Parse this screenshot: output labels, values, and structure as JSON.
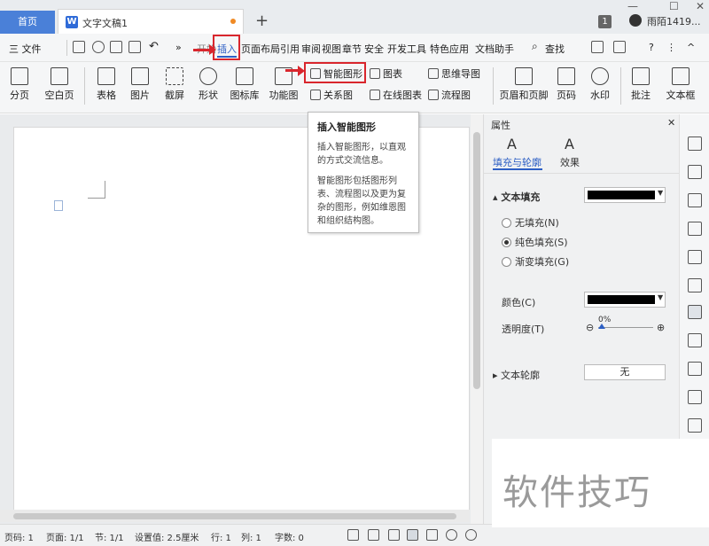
{
  "titlebar": {
    "home_tab": "首页",
    "doc_tab": "文字文稿1",
    "badge": "1",
    "user": "雨陌1419..."
  },
  "menubar": {
    "file": "三 文件",
    "tabs": [
      "开始",
      "插入",
      "页面布局",
      "引用",
      "审阅",
      "视图",
      "章节",
      "安全",
      "开发工具",
      "特色应用",
      "文档助手"
    ],
    "search": "查找"
  },
  "ribbon": {
    "big_buttons": [
      {
        "label": "分页",
        "icon": "page-break-icon"
      },
      {
        "label": "空白页",
        "icon": "blank-page-icon"
      },
      {
        "label": "表格",
        "icon": "table-icon"
      },
      {
        "label": "图片",
        "icon": "picture-icon"
      },
      {
        "label": "截屏",
        "icon": "screenshot-icon"
      },
      {
        "label": "形状",
        "icon": "shape-icon"
      },
      {
        "label": "图标库",
        "icon": "icon-library-icon"
      },
      {
        "label": "功能图",
        "icon": "function-chart-icon"
      },
      {
        "label": "页眉和页脚",
        "icon": "header-footer-icon"
      },
      {
        "label": "页码",
        "icon": "page-number-icon"
      },
      {
        "label": "水印",
        "icon": "watermark-icon"
      },
      {
        "label": "批注",
        "icon": "comment-icon"
      },
      {
        "label": "文本框",
        "icon": "textbox-icon"
      }
    ],
    "smart_art": "智能图形",
    "chart": "图表",
    "mindmap": "思维导图",
    "relation": "关系图",
    "online_chart": "在线图表",
    "flowchart": "流程图"
  },
  "tooltip": {
    "title": "插入智能图形",
    "line1": "插入智能图形，以直观的方式交流信息。",
    "line2": "智能图形包括图形列表、流程图以及更为复杂的图形，例如维恩图和组织结构图。"
  },
  "panel": {
    "title": "属性",
    "tab_fill": "填充与轮廓",
    "tab_effect": "效果",
    "text_fill": "文本填充",
    "no_fill": "无填充(N)",
    "solid_fill": "纯色填充(S)",
    "gradient_fill": "渐变填充(G)",
    "color": "颜色(C)",
    "transparency": "透明度(T)",
    "transparency_value": "0%",
    "text_outline": "文本轮廓",
    "outline_value": "无",
    "fill_color": "#000000"
  },
  "status": {
    "page": "页码: 1",
    "pages": "页面: 1/1",
    "section": "节: 1/1",
    "setting": "设置值: 2.5厘米",
    "row": "行: 1",
    "col": "列: 1",
    "words": "字数: 0"
  },
  "watermark": "软件技巧",
  "colors": {
    "accent": "#4a80d8",
    "highlight": "#d9262d"
  }
}
